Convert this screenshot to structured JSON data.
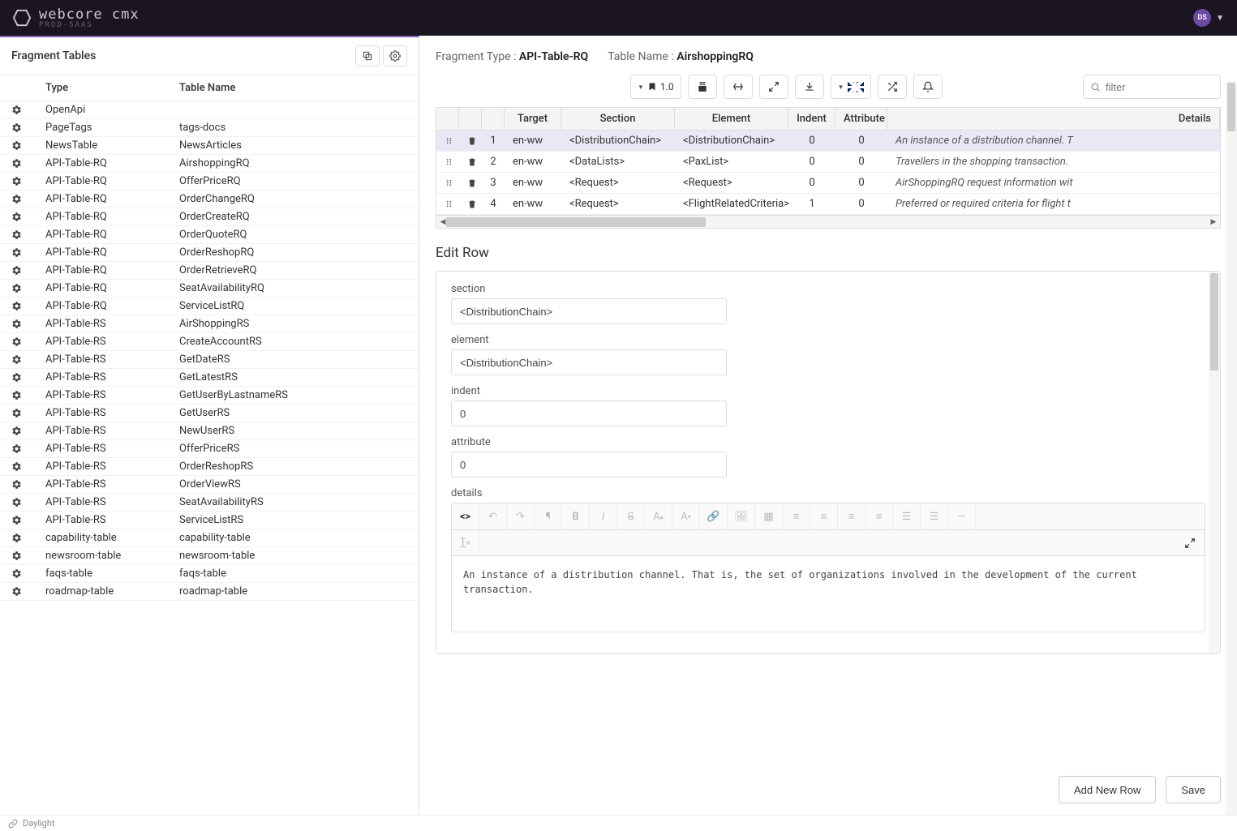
{
  "brand": {
    "name": "webcore cmx",
    "sub": "PROD-SAAS"
  },
  "avatar": "DS",
  "leftPanel": {
    "title": "Fragment Tables",
    "columns": {
      "type": "Type",
      "name": "Table Name"
    },
    "rows": [
      {
        "type": "OpenApi",
        "name": ""
      },
      {
        "type": "PageTags",
        "name": "tags-docs"
      },
      {
        "type": "NewsTable",
        "name": "NewsArticles"
      },
      {
        "type": "API-Table-RQ",
        "name": "AirshoppingRQ"
      },
      {
        "type": "API-Table-RQ",
        "name": "OfferPriceRQ"
      },
      {
        "type": "API-Table-RQ",
        "name": "OrderChangeRQ"
      },
      {
        "type": "API-Table-RQ",
        "name": "OrderCreateRQ"
      },
      {
        "type": "API-Table-RQ",
        "name": "OrderQuoteRQ"
      },
      {
        "type": "API-Table-RQ",
        "name": "OrderReshopRQ"
      },
      {
        "type": "API-Table-RQ",
        "name": "OrderRetrieveRQ"
      },
      {
        "type": "API-Table-RQ",
        "name": "SeatAvailabilityRQ"
      },
      {
        "type": "API-Table-RQ",
        "name": "ServiceListRQ"
      },
      {
        "type": "API-Table-RS",
        "name": "AirShoppingRS"
      },
      {
        "type": "API-Table-RS",
        "name": "CreateAccountRS"
      },
      {
        "type": "API-Table-RS",
        "name": "GetDateRS"
      },
      {
        "type": "API-Table-RS",
        "name": "GetLatestRS"
      },
      {
        "type": "API-Table-RS",
        "name": "GetUserByLastnameRS"
      },
      {
        "type": "API-Table-RS",
        "name": "GetUserRS"
      },
      {
        "type": "API-Table-RS",
        "name": "NewUserRS"
      },
      {
        "type": "API-Table-RS",
        "name": "OfferPriceRS"
      },
      {
        "type": "API-Table-RS",
        "name": "OrderReshopRS"
      },
      {
        "type": "API-Table-RS",
        "name": "OrderViewRS"
      },
      {
        "type": "API-Table-RS",
        "name": "SeatAvailabilityRS"
      },
      {
        "type": "API-Table-RS",
        "name": "ServiceListRS"
      },
      {
        "type": "capability-table",
        "name": "capability-table"
      },
      {
        "type": "newsroom-table",
        "name": "newsroom-table"
      },
      {
        "type": "faqs-table",
        "name": "faqs-table"
      },
      {
        "type": "roadmap-table",
        "name": "roadmap-table"
      }
    ]
  },
  "rightPanel": {
    "header": {
      "fragmentTypeLabel": "Fragment Type :",
      "fragmentTypeValue": "API-Table-RQ",
      "tableNameLabel": "Table Name :",
      "tableNameValue": "AirshoppingRQ"
    },
    "toolbar": {
      "version": "1.0",
      "filterPlaceholder": "filter"
    },
    "grid": {
      "columns": {
        "target": "Target",
        "section": "Section",
        "element": "Element",
        "indent": "Indent",
        "attribute": "Attribute",
        "details": "Details"
      },
      "rows": [
        {
          "num": "1",
          "target": "en-ww",
          "section": "<DistributionChain>",
          "element": "<DistributionChain>",
          "indent": "0",
          "attribute": "0",
          "details": "An instance of a distribution channel. T"
        },
        {
          "num": "2",
          "target": "en-ww",
          "section": "<DataLists>",
          "element": "<PaxList>",
          "indent": "0",
          "attribute": "0",
          "details": "Travellers in the shopping transaction."
        },
        {
          "num": "3",
          "target": "en-ww",
          "section": "<Request>",
          "element": "<Request>",
          "indent": "0",
          "attribute": "0",
          "details": "AirShoppingRQ request information wit"
        },
        {
          "num": "4",
          "target": "en-ww",
          "section": "<Request>",
          "element": "<FlightRelatedCriteria>",
          "indent": "1",
          "attribute": "0",
          "details": "Preferred or required criteria for flight t"
        }
      ]
    },
    "edit": {
      "title": "Edit Row",
      "labels": {
        "section": "section",
        "element": "element",
        "indent": "indent",
        "attribute": "attribute",
        "details": "details"
      },
      "values": {
        "section": "<DistributionChain>",
        "element": "<DistributionChain>",
        "indent": "0",
        "attribute": "0",
        "details": "An instance of a distribution channel. That is, the set of organizations involved in the development of the current transaction."
      }
    },
    "footer": {
      "addRow": "Add New Row",
      "save": "Save"
    }
  },
  "statusbar": {
    "text": "Daylight"
  }
}
